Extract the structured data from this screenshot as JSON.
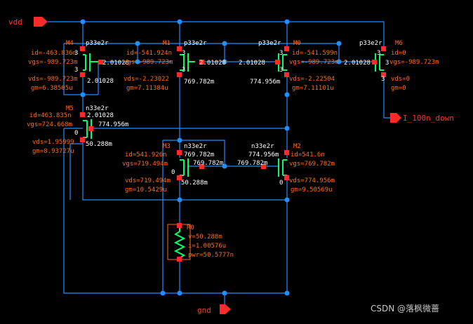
{
  "pins": {
    "vdd": "vdd",
    "gnd": "gnd",
    "out": "I_100n_down"
  },
  "watermark": "CSDN @落枫微蔷",
  "M4": {
    "name": "M4",
    "model": "p33e2r",
    "id": "id=-463.836n",
    "vgs": "vgs=-989.723m",
    "vds": "vds=-989.723m",
    "gm": "gm=6.38505u",
    "pin3a": "3",
    "pin3b": "3",
    "pin3c": "3",
    "node": "2.01028",
    "node_s": "2.01028"
  },
  "M1": {
    "name": "M1",
    "model": "p33e2r",
    "id": "id=-541.924n",
    "vgs": "vgs=-989.723m",
    "vds": "vds=-2.23022",
    "gm": "gm=7.11384u",
    "pin3a": "3",
    "pin3b": "3",
    "node_g": "2.01028",
    "node_d": "769.782m"
  },
  "M0": {
    "name": "M0",
    "model": "p33e2r",
    "id": "id=-541.599n",
    "vgs": "vgs=-989.723m",
    "vds": "vds=-2.22504",
    "gm": "gm=7.11101u",
    "pin3a": "3",
    "pin3b": "3",
    "node_g": "2.01028",
    "node_d": "774.956m"
  },
  "M6": {
    "name": "M6",
    "model": "p33e2r",
    "id": "id=0",
    "vgs": "vgs=-989.723m",
    "vds": "vds=0",
    "gm": "gm=0",
    "pin3a": "3",
    "pin3b": "3",
    "pin3c": "3",
    "node_g": "2.01028"
  },
  "M5": {
    "name": "M5",
    "model": "n33e2r",
    "id": "id=463.835n",
    "vgs": "vgs=724.668m",
    "vds": "vds=1.95999",
    "gm": "gm=8.93727u",
    "pin0": "0",
    "node_d": "2.01028",
    "node_g": "774.956m",
    "node_s": "50.288m"
  },
  "M3": {
    "name": "M3",
    "model": "n33e2r",
    "id": "id=541.926n",
    "vgs": "vgs=719.494m",
    "vds": "vds=719.494m",
    "gm": "gm=10.5429u",
    "pin0": "0",
    "node_d": "769.782m",
    "node_g": "769.782m",
    "node_s": "50.288m"
  },
  "M2": {
    "name": "M2",
    "model": "n33e2r",
    "id": "id=541.6n",
    "vgs": "vgs=769.782m",
    "vds": "vds=774.956m",
    "gm": "gm=9.50569u",
    "pin0": "0",
    "node_d": "774.956m",
    "node_g": "769.782m"
  },
  "R0": {
    "name": "R0",
    "v": "v=50.288m",
    "i": "i=1.00576u",
    "pwr": "pwr=50.5777n"
  },
  "colors": {
    "wire": "#1e90ff",
    "device": "#00ff66",
    "pin": "#ff2a2a",
    "label": "#ff6a1a",
    "text": "#ffffff",
    "dot": "#1e90ff"
  }
}
